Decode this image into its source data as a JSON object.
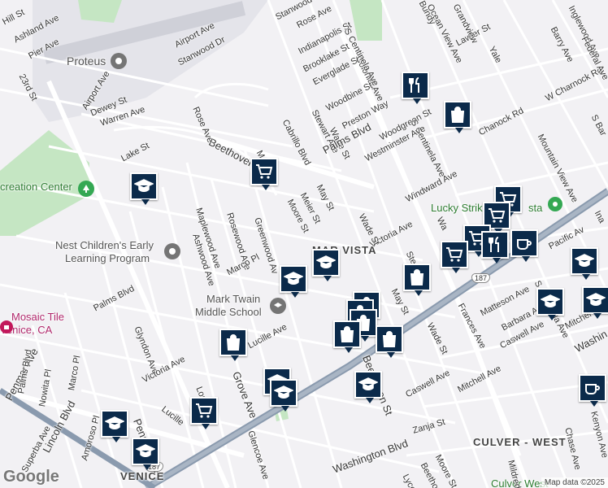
{
  "map": {
    "attribution": "Map data ©2025",
    "logo": "Google",
    "colors": {
      "road": "#ffffff",
      "highway": "#8a9aae",
      "park": "#c6e8c6",
      "airport": "#e3e3e8",
      "pin": "#0b2a4a",
      "poi_gray": "#757575",
      "poi_green": "#34a853",
      "poi_pink": "#c2185b",
      "water_text": "#b0276b"
    },
    "neighborhoods": [
      {
        "id": "mar-vista",
        "text": "MAR VISTA"
      },
      {
        "id": "culver-west",
        "text": "CULVER - WEST"
      },
      {
        "id": "venice",
        "text": "VENICE"
      }
    ],
    "places": [
      {
        "id": "proteus",
        "text": "Proteus",
        "icon": "place-icon"
      },
      {
        "id": "recreation",
        "text": "creation Center",
        "icon": "park-icon"
      },
      {
        "id": "nest1",
        "text": "Nest Children's Early",
        "icon": "school-icon"
      },
      {
        "id": "nest2",
        "text": "Learning Program",
        "icon": ""
      },
      {
        "id": "twain1",
        "text": "Mark Twain",
        "icon": ""
      },
      {
        "id": "twain2",
        "text": "Middle School",
        "icon": "school-icon"
      },
      {
        "id": "mosaic1",
        "text": "Mosaic Tile",
        "icon": "shopping-icon"
      },
      {
        "id": "mosaic2",
        "text": "Venice, CA",
        "icon": ""
      },
      {
        "id": "lucky",
        "text": "Lucky Strike",
        "icon": "bowling-icon"
      },
      {
        "id": "lucky-end",
        "text": "sta",
        "icon": ""
      },
      {
        "id": "culverwest-poi",
        "text": "Culver West",
        "icon": ""
      }
    ],
    "streets": [
      "Hill St",
      "Ashland Ave",
      "Pier Ave",
      "23rd St",
      "Airport Ave",
      "Dewey St",
      "Warren Ave",
      "Airport Ave",
      "Stanwood Dr",
      "Stanwood Pl",
      "Rose Ave",
      "Indianapolis St",
      "Brooklake St",
      "Everglade St",
      "Colonial Ave",
      "S Centinela Ave",
      "Woodbine St",
      "Preston Way",
      "Stewart Ave",
      "Wade St",
      "Palms Blvd",
      "Woodgreen St",
      "S Centinela Ave",
      "Westminster Ave",
      "Chanock Rd",
      "W Charnock Rd",
      "Lawler St",
      "Barry Ave",
      "Mountain View Ave",
      "Cabrillo Blvd",
      "Beethoven St",
      "Rose Ave",
      "Lake St",
      "Mo",
      "May St",
      "Meier St",
      "Moore St",
      "Windward Ave",
      "Victoria Ave",
      "Wade St",
      "Maplewood Ave",
      "Rosewood Ave",
      "Greenwood Av",
      "Ashwood Ave",
      "Marco Pl",
      "Palms Blvd",
      "Penmar Ave",
      "Glyndon Ave",
      "Lucille Ave",
      "Grove Ave",
      "May St",
      "Wade St",
      "Frances Ave",
      "Matteson Ave",
      "Barbara Ave",
      "Caswell Ave",
      "Mitchel",
      "Washin",
      "Pacific Av",
      "Victoria Ave",
      "Palms Blvd",
      "Nowita Pl",
      "Marco Pl",
      "Lucille",
      "Louella",
      "Glencoe Ave",
      "Lincoln Blvd",
      "Superba Ave",
      "Amoroso Pl",
      "Penmar Ave",
      "Beethoven St",
      "Caswell Ave",
      "Mitchell Ave",
      "Zanja St",
      "Moore St",
      "Washington Blvd",
      "Lyceum",
      "Beethoven",
      "Mildred",
      "Chase Ave",
      "Kenyon Ave",
      "S Centinela Ave",
      "Bo",
      "Ste",
      "Wa",
      "Yale",
      "Ina",
      "S Bar",
      "Inglewood Ave",
      "Federal Ave",
      "Ocean View Ave",
      "Grandview",
      "Bundy"
    ],
    "routes": [
      "187",
      "187",
      "187"
    ],
    "pins": [
      {
        "id": "pin-restaurant-colonial",
        "icon": "restaurant-icon"
      },
      {
        "id": "pin-shopping-palms",
        "icon": "shopping-bag-icon"
      },
      {
        "id": "pin-cart-beethoven",
        "icon": "shopping-cart-icon"
      },
      {
        "id": "pin-school-lake",
        "icon": "school-icon"
      },
      {
        "id": "pin-cart-lucky",
        "icon": "shopping-cart-icon"
      },
      {
        "id": "pin-cart-lucky2",
        "icon": "shopping-cart-icon"
      },
      {
        "id": "pin-cart-centinela",
        "icon": "shopping-cart-icon"
      },
      {
        "id": "pin-restaurant-centinela",
        "icon": "restaurant-icon"
      },
      {
        "id": "pin-cafe-centinela",
        "icon": "cafe-icon"
      },
      {
        "id": "pin-cart-bolton",
        "icon": "shopping-cart-icon"
      },
      {
        "id": "pin-school-pacific",
        "icon": "school-icon"
      },
      {
        "id": "pin-school-marvista1",
        "icon": "school-icon"
      },
      {
        "id": "pin-school-marvista2",
        "icon": "school-icon"
      },
      {
        "id": "pin-shopping-victoria",
        "icon": "shopping-bag-icon"
      },
      {
        "id": "pin-shopping-may1",
        "icon": "shopping-bag-icon"
      },
      {
        "id": "pin-shopping-may2",
        "icon": "shopping-bag-icon"
      },
      {
        "id": "pin-shopping-may3",
        "icon": "shopping-bag-icon"
      },
      {
        "id": "pin-shopping-may4",
        "icon": "shopping-bag-icon"
      },
      {
        "id": "pin-shopping-venice",
        "icon": "shopping-bag-icon"
      },
      {
        "id": "pin-shopping-beethoven",
        "icon": "shopping-bag-icon"
      },
      {
        "id": "pin-shopping-lucille",
        "icon": "shopping-bag-icon"
      },
      {
        "id": "pin-school-grove",
        "icon": "school-icon"
      },
      {
        "id": "pin-school-grove2",
        "icon": "school-icon"
      },
      {
        "id": "pin-school-beethoven",
        "icon": "school-icon"
      },
      {
        "id": "pin-cart-glencoe",
        "icon": "shopping-cart-icon"
      },
      {
        "id": "pin-school-lincoln",
        "icon": "school-icon"
      },
      {
        "id": "pin-school-venice",
        "icon": "school-icon"
      },
      {
        "id": "pin-school-matteson",
        "icon": "school-icon"
      },
      {
        "id": "pin-school-mitchell",
        "icon": "school-icon"
      },
      {
        "id": "pin-cafe-kenyon",
        "icon": "cafe-icon"
      }
    ]
  }
}
